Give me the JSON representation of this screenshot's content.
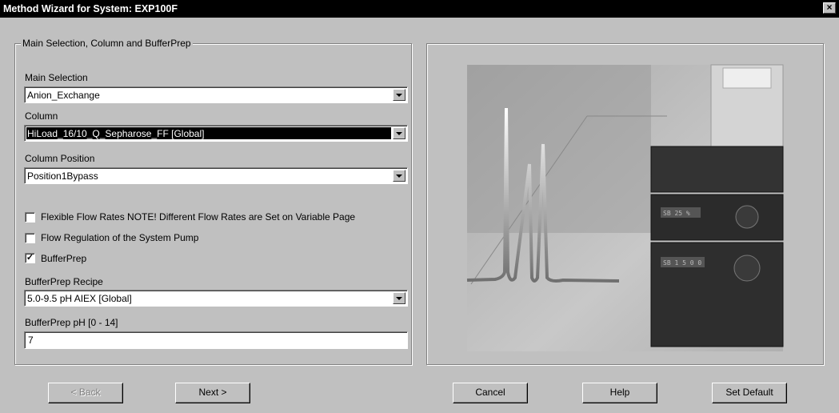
{
  "window": {
    "title": "Method Wizard for System: EXP100F",
    "close_label": "×"
  },
  "group": {
    "title": "Main Selection, Column and BufferPrep"
  },
  "main_selection": {
    "label": "Main Selection",
    "value": "Anion_Exchange"
  },
  "column": {
    "label": "Column",
    "value": "HiLoad_16/10_Q_Sepharose_FF [Global]"
  },
  "column_position": {
    "label": "Column Position",
    "value": "Position1Bypass"
  },
  "checkboxes": [
    {
      "label": "Flexible Flow Rates   NOTE! Different Flow Rates are Set on Variable Page",
      "checked": false
    },
    {
      "label": "Flow Regulation of the System Pump",
      "checked": false
    },
    {
      "label": "BufferPrep",
      "checked": true
    }
  ],
  "bufferprep_recipe": {
    "label": "BufferPrep Recipe",
    "value": "5.0-9.5 pH AIEX [Global]"
  },
  "bufferprep_ph": {
    "label": "BufferPrep pH [0 - 14]",
    "value": "7"
  },
  "instrument_displays": [
    "SB 25 %",
    "SB 1 5 0 0"
  ],
  "buttons": {
    "back": "< Back",
    "next": "Next >",
    "cancel": "Cancel",
    "help": "Help",
    "set_default": "Set Default"
  },
  "colors": {
    "titlebar": "#000000",
    "face": "#c0c0c0",
    "selection": "#000000"
  }
}
